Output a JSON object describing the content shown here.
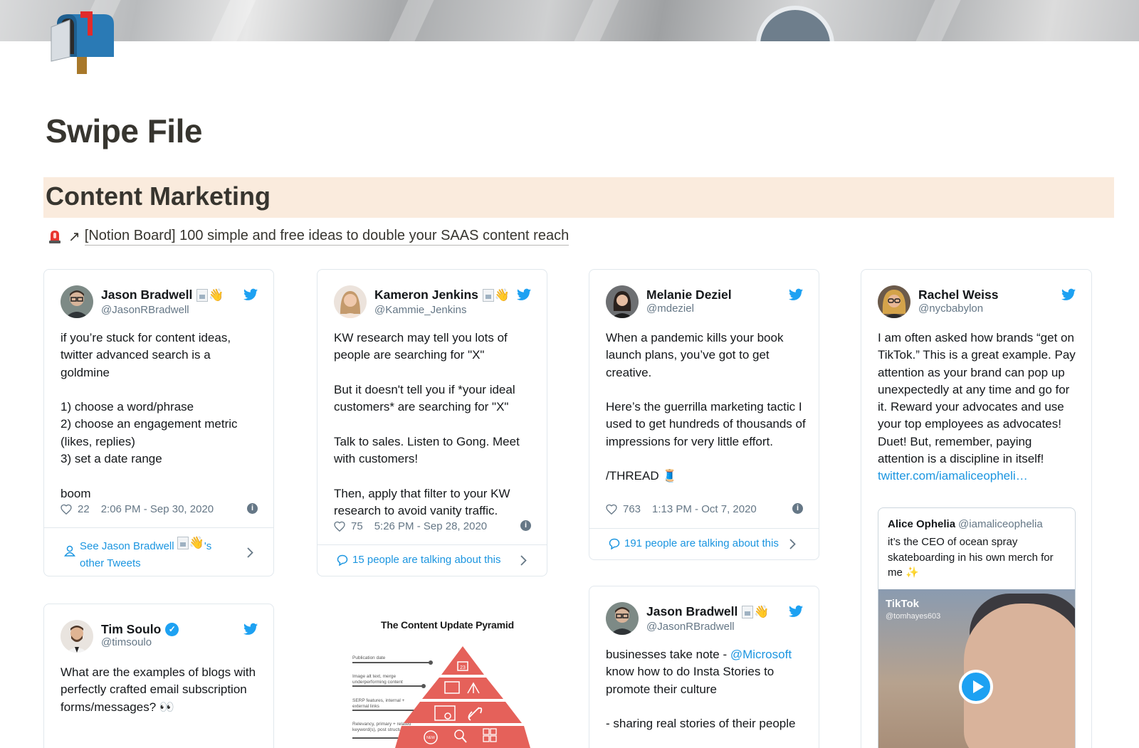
{
  "page": {
    "title": "Swipe File",
    "section_heading": "Content Marketing",
    "link": {
      "icon": "siren-emoji-icon",
      "text": "[Notion Board] 100 simple and free ideas to double your SAAS content reach"
    }
  },
  "colors": {
    "section_highlight": "#faebdd",
    "twitter_blue": "#1da1f2",
    "link_blue": "#1b95e0",
    "pyramid_red": "#e5615a"
  },
  "tweets": [
    {
      "name": "Jason Bradwell",
      "handle": "@JasonRBradwell",
      "body": "if you’re stuck for content ideas, twitter advanced search is a goldmine\n\n1) choose a word/phrase\n2) choose an engagement metric (likes, replies)\n3) set a date range\n\nboom",
      "likes": "22",
      "timestamp": "2:06 PM - Sep 30, 2020",
      "footer_line1": "See Jason Bradwell",
      "footer_line1_suffix": "'s",
      "footer_line2": "other Tweets"
    },
    {
      "name": "Kameron Jenkins",
      "handle": "@Kammie_Jenkins",
      "body": "KW research may tell you lots of people are searching for \"X\"\n\nBut it doesn't tell you if *your ideal customers* are searching for \"X\"\n\nTalk to sales. Listen to Gong. Meet with customers!\n\nThen, apply that filter to your KW research to avoid vanity traffic.",
      "likes": "75",
      "timestamp": "5:26 PM - Sep 28, 2020",
      "footer": "15 people are talking about this"
    },
    {
      "name": "Melanie Deziel",
      "handle": "@mdeziel",
      "body": "When a pandemic kills your book launch plans, you’ve got to get creative.\n\nHere’s the guerrilla marketing tactic I used to get hundreds of thousands of impressions for very little effort.\n\n/THREAD 🧵",
      "likes": "763",
      "timestamp": "1:13 PM - Oct 7, 2020",
      "footer": "191 people are talking about this"
    },
    {
      "name": "Rachel Weiss",
      "handle": "@nycbabylon",
      "body": "I am often asked how brands “get on TikTok.” This is a great example. Pay attention as your brand can pop up unexpectedly at any time and go for it. Reward your advocates and use your top employees as advocates! Duet! But, remember, paying attention is a discipline in itself!",
      "link": "twitter.com/iamaliceopheli…",
      "quote": {
        "name": "Alice Ophelia",
        "handle": "@iamaliceophelia",
        "body": "it’s the CEO of ocean spray skateboarding in his own merch for me ✨",
        "media_badge": "TikTok",
        "media_handle": "@tomhayes603"
      }
    },
    {
      "name": "Tim Soulo",
      "handle": "@timsoulo",
      "body": "What are the examples of blogs with perfectly crafted email subscription forms/messages? 👀"
    },
    {
      "name": "Jason Bradwell",
      "handle": "@JasonRBradwell",
      "body_prefix": "businesses take note - ",
      "mention": "@Microsoft",
      "body_rest": "know how to do Insta Stories to promote their culture\n\n- sharing real stories of their people"
    }
  ],
  "pyramid": {
    "title": "The Content Update Pyramid",
    "labels": [
      "Publication date",
      "Image alt text, merge underperforming content",
      "SERP features, internal + external links",
      "Relevancy, primary + related keyword(s), post structure"
    ]
  }
}
